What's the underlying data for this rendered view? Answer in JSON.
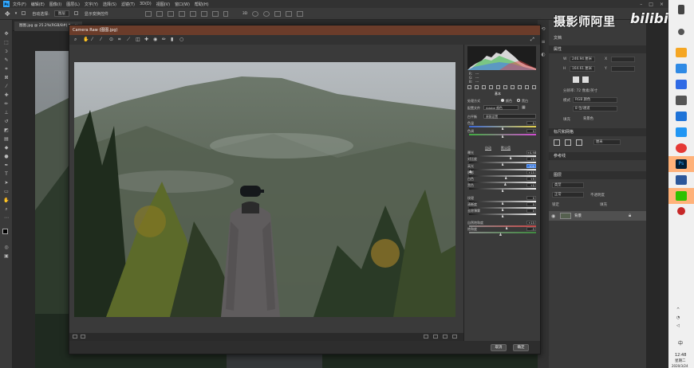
{
  "menubar": {
    "items": [
      "文件(F)",
      "编辑(E)",
      "图像(I)",
      "图层(L)",
      "文字(Y)",
      "选择(S)",
      "滤镜(T)",
      "3D(D)",
      "视图(V)",
      "窗口(W)",
      "帮助(H)"
    ],
    "ps_badge": "Ps"
  },
  "optbar": {
    "auto_select": "自动选择:",
    "select_value": "图层",
    "show_transform": "显示变换控件"
  },
  "document_tab": "图图.jpg @ 25.2%(RGB/8#) *",
  "dialog": {
    "title": "Camera Raw (图图.jpg)",
    "panel_title": "基本",
    "hist_readout": {
      "r": "R:",
      "g": "G:",
      "b": "B:",
      "r_val": "---",
      "g_val": "---",
      "b_val": "---"
    },
    "treatment_label": "处理方式",
    "treatment_color": "颜色",
    "treatment_bw": "黑白",
    "profile_label": "配置文件",
    "profile_value": "Adobe 颜色",
    "wb_label": "白平衡",
    "wb_value": "原照设置",
    "auto_btn": "自动",
    "default_btn": "默认值",
    "sliders": [
      {
        "label": "色温",
        "value": "0",
        "pos": 0.5,
        "gradient": "temp"
      },
      {
        "label": "色调",
        "value": "0",
        "pos": 0.5,
        "gradient": "tint"
      },
      {
        "label": "曝光",
        "value": "+0.90",
        "pos": 0.62,
        "gradient": "gray"
      },
      {
        "label": "对比度",
        "value": "+0",
        "pos": 0.5,
        "gradient": "gray"
      },
      {
        "label": "高光",
        "value": "-100",
        "pos": 0.02,
        "gradient": "gray",
        "highlighted": true
      },
      {
        "label": "阴影",
        "value": "+15",
        "pos": 0.55,
        "gradient": "gray"
      },
      {
        "label": "白色",
        "value": "+9",
        "pos": 0.54,
        "gradient": "gray"
      },
      {
        "label": "黑色",
        "value": "+0",
        "pos": 0.5,
        "gradient": "gray"
      },
      {
        "label": "纹理",
        "value": "0",
        "pos": 0.5,
        "gradient": "gray"
      },
      {
        "label": "清晰度",
        "value": "0",
        "pos": 0.5,
        "gradient": "gray"
      },
      {
        "label": "去除薄雾",
        "value": "0",
        "pos": 0.5,
        "gradient": "gray"
      },
      {
        "label": "自然饱和度",
        "value": "+15",
        "pos": 0.56,
        "gradient": "vib"
      },
      {
        "label": "饱和度",
        "value": "-5",
        "pos": 0.47,
        "gradient": "sat"
      }
    ],
    "cancel": "取消",
    "ok": "确定"
  },
  "right_panel": {
    "doc_label": "文档",
    "properties_title": "属性",
    "w_label": "W",
    "w_value": "246.94 厘米",
    "h_label": "H",
    "h_value": "164.61 厘米",
    "x_label": "X",
    "y_label": "Y",
    "resolution": "分辨率: 72 像素/英寸",
    "mode_label": "模式",
    "mode_value": "RGB 颜色",
    "bitdepth_value": "8 位/通道",
    "fill_label": "填充",
    "fill_value": "背景色",
    "rulers_title": "标尺和网格",
    "units_value": "厘米",
    "guides_title": "参考线",
    "layers_title": "图层",
    "kind_value": "类型",
    "blend_value": "正常",
    "opacity_label": "不透明度",
    "lock_label": "锁定",
    "fill2_label": "填充",
    "layer_name": "背景"
  },
  "watermark": {
    "text": "摄影师阿里",
    "brand": "bilibili"
  },
  "taskbar": {
    "time": "12:48",
    "day": "星期二",
    "date": "2020/3/24",
    "lang": "中"
  },
  "colors": {
    "dialog_title_bg": "#6b3c2a",
    "photoshop_blue": "#31a8ff",
    "taskbar_active": "#ffb27a"
  }
}
